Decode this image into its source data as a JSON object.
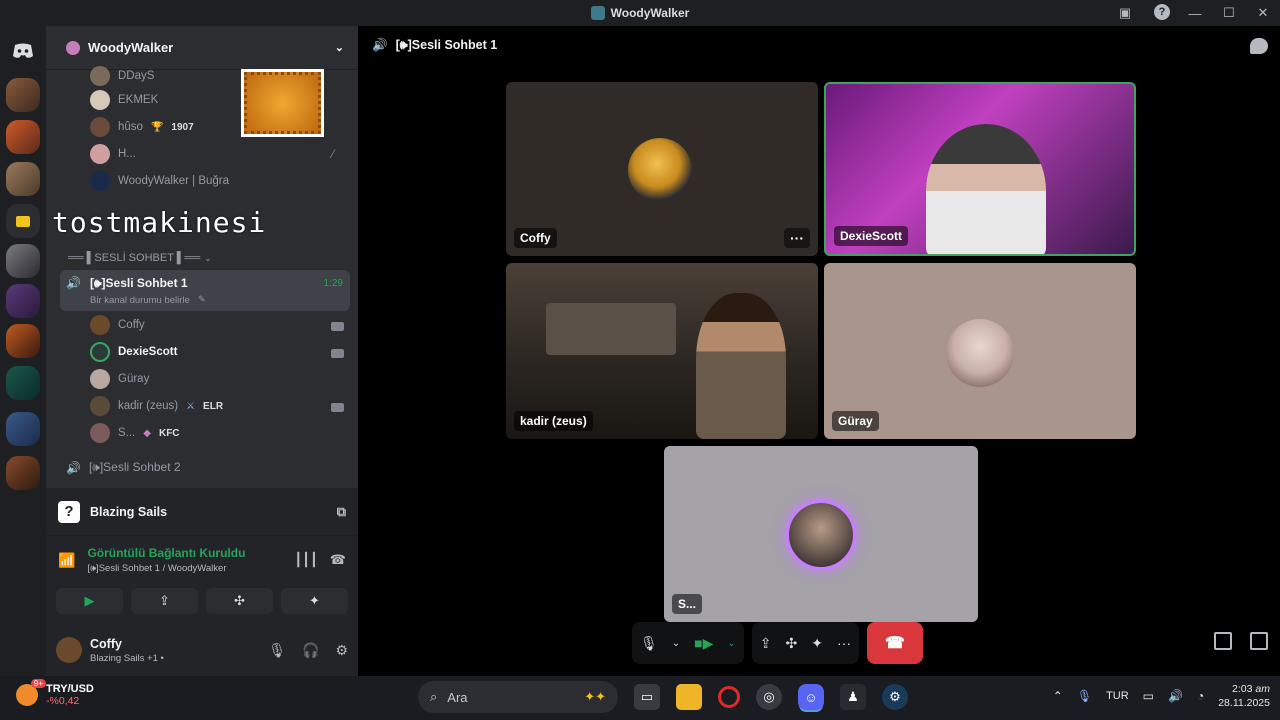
{
  "window": {
    "title": "WoodyWalker"
  },
  "server": {
    "name": "WoodyWalker"
  },
  "members_above": [
    {
      "name": "DDayS",
      "badge": ""
    },
    {
      "name": "EKMEK",
      "badge": ""
    },
    {
      "name": "hûso",
      "badge": "1907"
    },
    {
      "name": "H...",
      "badge": ""
    },
    {
      "name": "WoodyWalker | Buğra",
      "badge": ""
    }
  ],
  "overlay_text": "tostmakinesi",
  "category": {
    "label": "══ ▌SESLİ SOHBET ▌══"
  },
  "active_channel": {
    "name": "[🕪]Sesli Sohbet 1",
    "duration": "1:29",
    "status_prompt": "Bir kanal durumu belirle"
  },
  "voice_members": [
    {
      "name": "Coffy",
      "badge": "",
      "camera": true
    },
    {
      "name": "DexieScott",
      "badge": "",
      "camera": true
    },
    {
      "name": "Güray",
      "badge": "",
      "camera": false
    },
    {
      "name": "kadir (zeus)",
      "badge": "ELR",
      "camera": true
    },
    {
      "name": "S...",
      "badge": "KFC",
      "camera": false
    }
  ],
  "channel2": {
    "name": "[🕪]Sesli Sohbet 2"
  },
  "activity": {
    "title": "Blazing Sails",
    "icon": "?"
  },
  "rtc": {
    "status": "Görüntülü Bağlantı Kuruldu",
    "location": "[🕪]Sesli Sohbet 1 / WoodyWalker"
  },
  "user": {
    "name": "Coffy",
    "status": "Blazing Sails +1 •"
  },
  "call": {
    "channel_title": "[🕪]Sesli Sohbet 1",
    "tiles": [
      {
        "name": "Coffy"
      },
      {
        "name": "DexieScott"
      },
      {
        "name": "kadir (zeus)"
      },
      {
        "name": "Güray"
      },
      {
        "name": "S..."
      }
    ],
    "more": "···"
  },
  "taskbar": {
    "currency": "TRY/USD",
    "change": "-%0,42",
    "badge": "9+",
    "search_placeholder": "Ara",
    "lang": "TUR",
    "time": "2:03",
    "ampm": "am",
    "date": "28.11.2025"
  },
  "colors": {
    "accent_green": "#23a55a",
    "hangup_red": "#da373c",
    "speaking_border": "#3ba55d"
  }
}
